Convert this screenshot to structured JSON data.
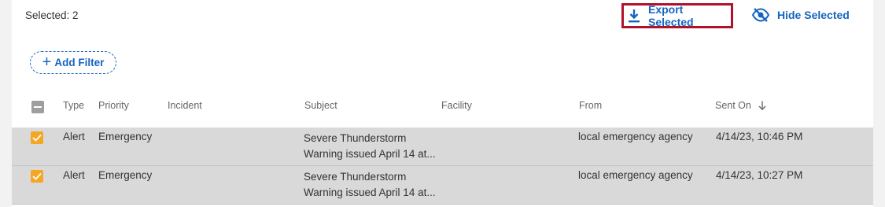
{
  "toolbar": {
    "selected_label": "Selected: 2",
    "export_label": "Export Selected",
    "hide_label": "Hide Selected",
    "add_filter_label": "Add Filter"
  },
  "table": {
    "columns": {
      "type": "Type",
      "priority": "Priority",
      "incident": "Incident",
      "subject": "Subject",
      "facility": "Facility",
      "from": "From",
      "sent_on": "Sent On"
    },
    "rows": [
      {
        "type": "Alert",
        "priority": "Emergency",
        "incident": "",
        "subject": "Severe Thunderstorm Warning issued April 14 at...",
        "facility": "",
        "from": "local emergency agency",
        "sent_on": "4/14/23, 10:46 PM"
      },
      {
        "type": "Alert",
        "priority": "Emergency",
        "incident": "",
        "subject": "Severe Thunderstorm Warning issued April 14 at...",
        "facility": "",
        "from": "local emergency agency",
        "sent_on": "4/14/23, 10:27 PM"
      }
    ]
  },
  "colors": {
    "accent": "#1565c0",
    "highlight_border": "#b0122b",
    "checkbox_checked": "#f5a623",
    "selected_row": "#d9d9d9"
  }
}
